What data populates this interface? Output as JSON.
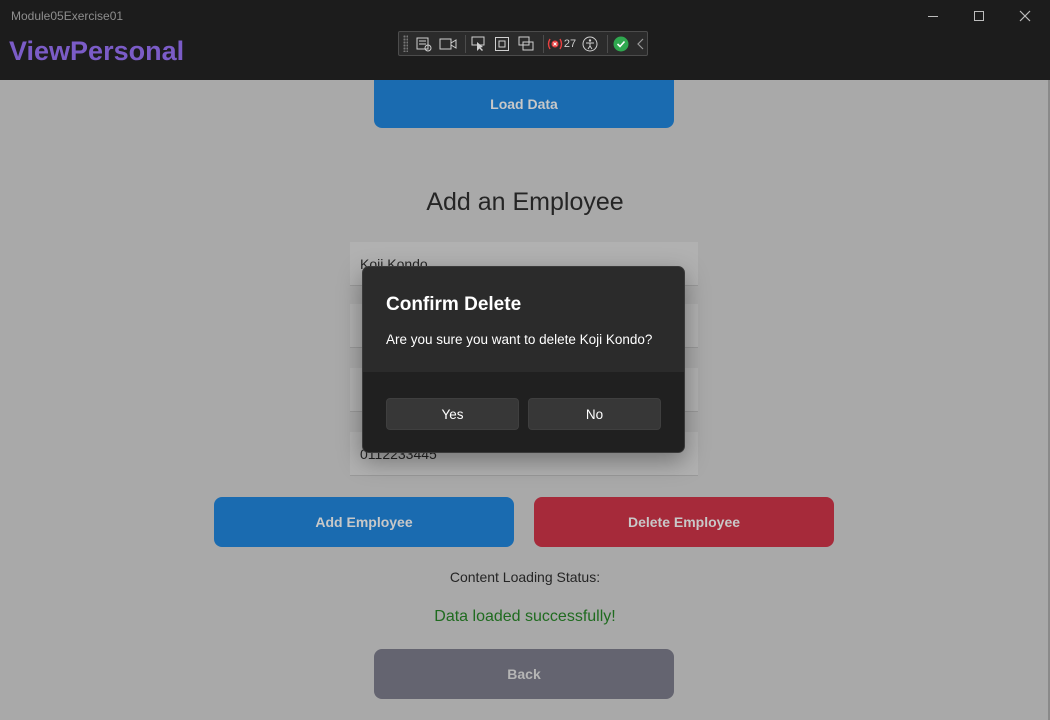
{
  "window": {
    "title": "Module05Exercise01",
    "page_title": "ViewPersonal"
  },
  "debug_toolbar": {
    "icons": [
      "select-element-icon",
      "video-icon",
      "pointer-icon",
      "frame-icon",
      "adorner-icon",
      "hot-reload-icon",
      "accessibility-icon",
      "check-icon",
      "chevron-left-icon"
    ],
    "binding_errors": "27",
    "accent_red": "#e84040",
    "accent_green": "#2fa84f"
  },
  "main": {
    "load_button": "Load Data",
    "section_title": "Add an Employee",
    "fields": {
      "name": "Koji Kondo",
      "phone": "0112233445"
    },
    "add_button": "Add Employee",
    "delete_button": "Delete Employee",
    "status_label": "Content Loading Status:",
    "status_value": "Data loaded successfully!",
    "back_button": "Back"
  },
  "dialog": {
    "title": "Confirm Delete",
    "message": "Are you sure you want to delete Koji Kondo?",
    "yes": "Yes",
    "no": "No"
  },
  "colors": {
    "accent_purple": "#7b5cc7",
    "blue": "#1a6bb0",
    "red": "#a62a3a",
    "status_green": "#1f6b1f"
  }
}
